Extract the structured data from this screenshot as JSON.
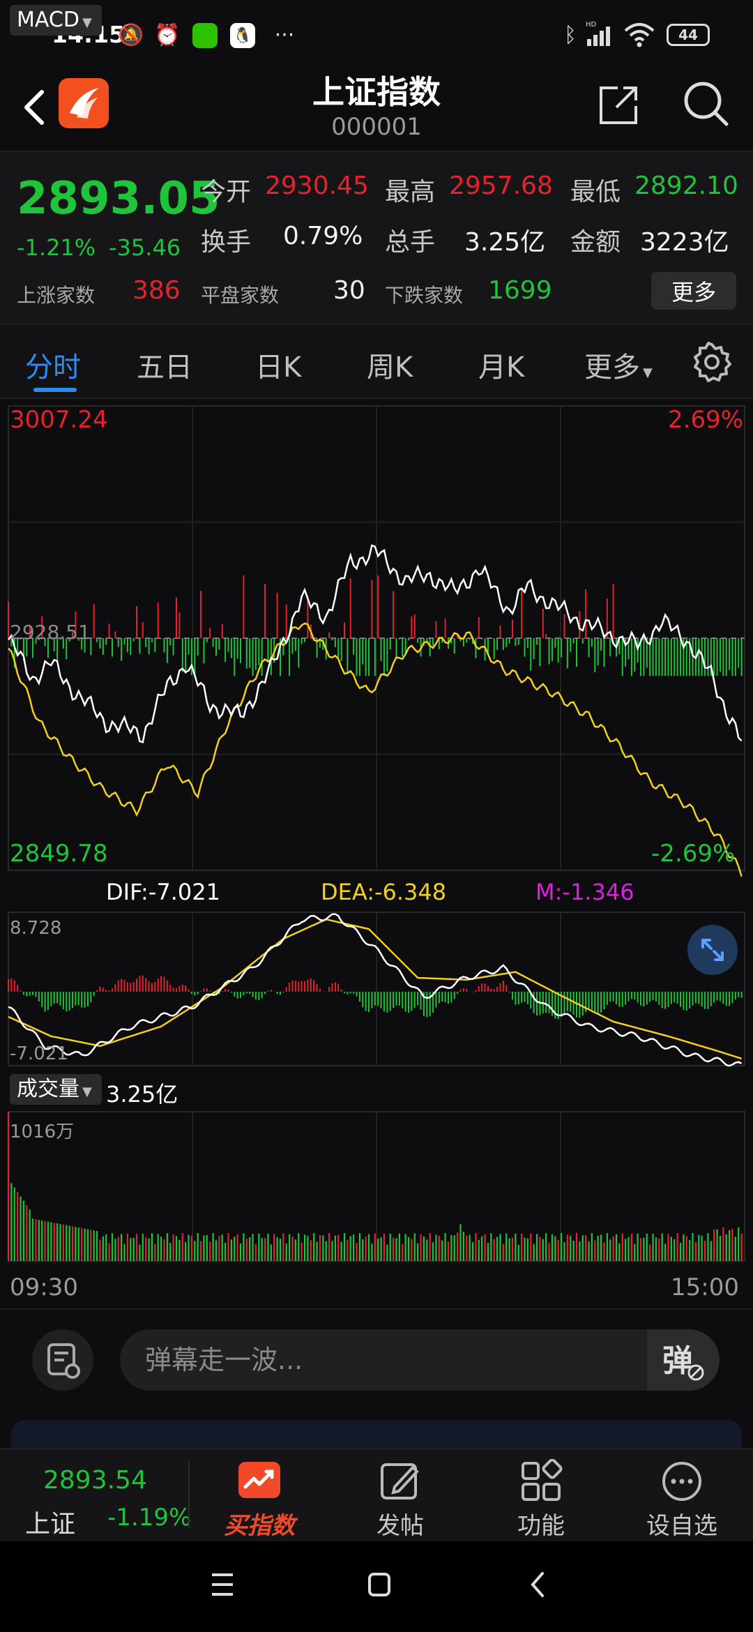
{
  "status_bar": {
    "time": "14:15",
    "battery": "44",
    "network": "HD"
  },
  "header": {
    "title": "上证指数",
    "code": "000001"
  },
  "quote": {
    "price": "2893.05",
    "change_pct": "-1.21%",
    "change": "-35.46",
    "open_label": "今开",
    "open": "2930.45",
    "high_label": "最高",
    "high": "2957.68",
    "low_label": "最低",
    "low": "2892.10",
    "turnover_label": "换手",
    "turnover": "0.79%",
    "volume_label": "总手",
    "volume": "3.25亿",
    "amount_label": "金额",
    "amount": "3223亿",
    "up_label": "上涨家数",
    "up": "386",
    "flat_label": "平盘家数",
    "flat": "30",
    "down_label": "下跌家数",
    "down": "1699",
    "more_label": "更多"
  },
  "tabs": {
    "items": [
      "分时",
      "五日",
      "日K",
      "周K",
      "月K",
      "更多"
    ],
    "active": "分时"
  },
  "intraday": {
    "max_price": "3007.24",
    "max_pct": "2.69%",
    "min_price": "2849.78",
    "min_pct": "-2.69%",
    "prev_close": "2928.51"
  },
  "macd": {
    "selector": "MACD",
    "dif": "DIF:-7.021",
    "dea": "DEA:-6.348",
    "m": "M:-1.346",
    "axis_max": "8.728",
    "axis_min": "-7.021"
  },
  "volume": {
    "selector": "成交量",
    "total": "3.25亿",
    "axis_max": "1016万"
  },
  "time_axis": {
    "start": "09:30",
    "end": "15:00"
  },
  "danmaku": {
    "placeholder": "弹幕走一波..."
  },
  "bottom_nav": {
    "index_price": "2893.54",
    "index_name": "上证",
    "index_pct": "-1.19%",
    "items": [
      "买指数",
      "发帖",
      "功能",
      "设自选"
    ]
  },
  "colors": {
    "up": "#e5232e",
    "down": "#1fc43a",
    "accent": "#2e8cf0",
    "price_line": "#ffffff",
    "avg_line": "#f2d01c",
    "macd_m": "#e020e0"
  }
}
